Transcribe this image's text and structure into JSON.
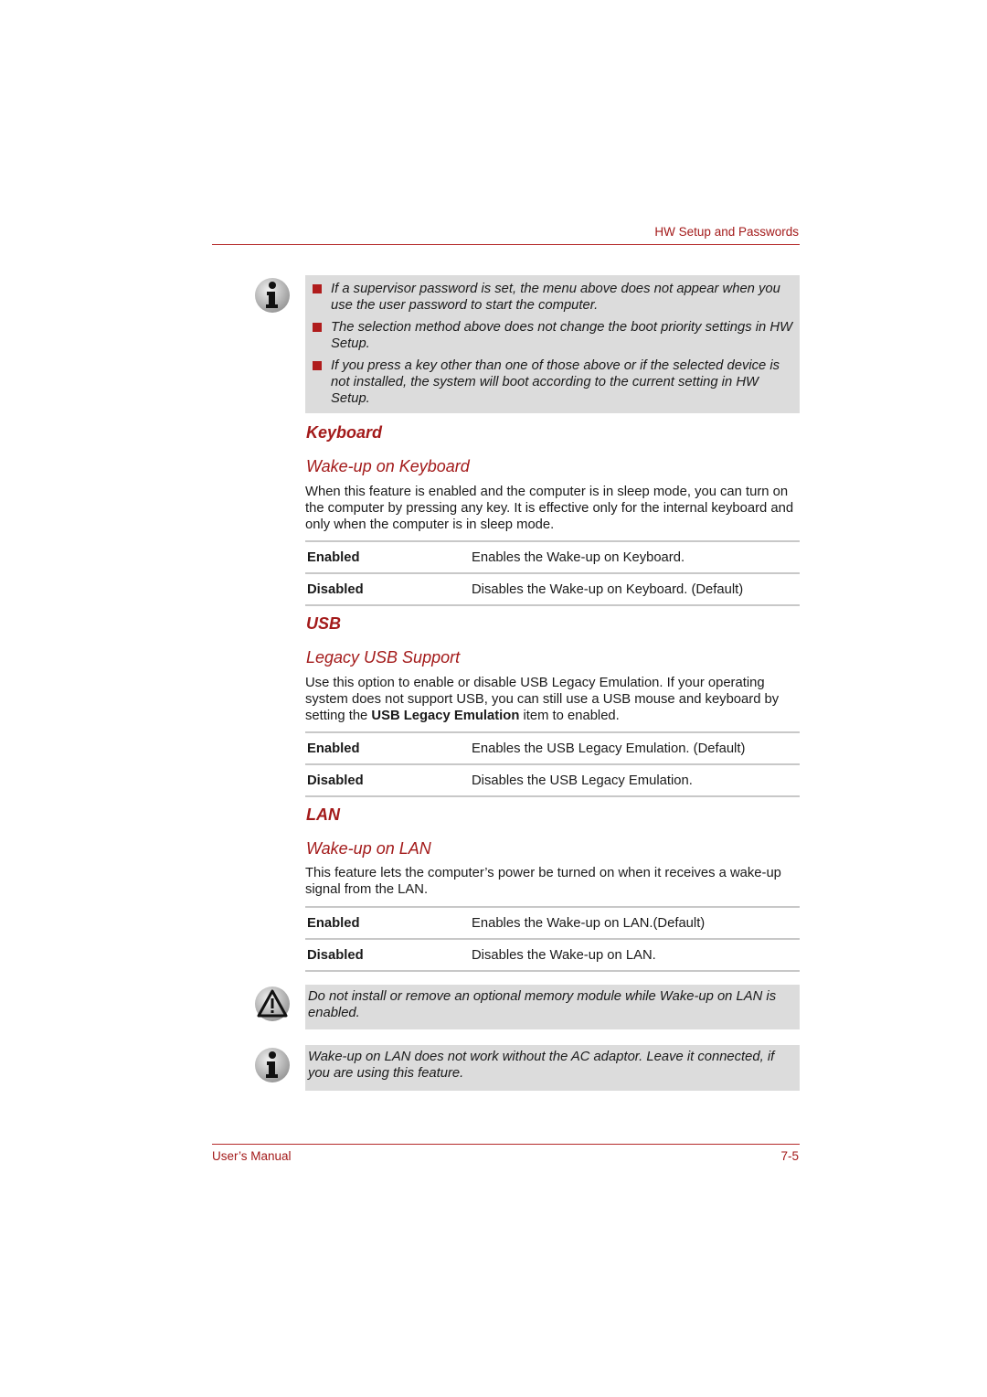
{
  "header": {
    "title": "HW Setup and Passwords"
  },
  "colors": {
    "accent": "#a31a1a",
    "note_bg": "#dcdcdc",
    "rule": "#c8c8c8"
  },
  "top_note": {
    "icon": "info-icon",
    "bullets": [
      "If a supervisor password is set, the menu above does not appear when you use the user password to start the computer.",
      "The selection method above does not change the boot priority settings in HW Setup.",
      "If you press a key other than one of those above or if the selected device is not installed, the system will boot according to the current setting in HW Setup."
    ]
  },
  "sections": {
    "keyboard": {
      "heading": "Keyboard",
      "subheading": "Wake-up on Keyboard",
      "description": "When this feature is enabled and the computer is in sleep mode, you can turn on the computer by pressing any key. It is effective only for the internal keyboard and only when the computer is in sleep mode.",
      "options": [
        {
          "key": "Enabled",
          "value": "Enables the Wake-up on Keyboard."
        },
        {
          "key": "Disabled",
          "value": "Disables the Wake-up on Keyboard. (Default)"
        }
      ]
    },
    "usb": {
      "heading": "USB",
      "subheading": "Legacy USB Support",
      "description_pre": "Use this option to enable or disable USB Legacy Emulation. If your operating system does not support USB, you can still use a USB mouse and keyboard by setting the ",
      "description_bold": "USB Legacy Emulation",
      "description_post": " item to enabled.",
      "options": [
        {
          "key": "Enabled",
          "value": "Enables the USB Legacy Emulation. (Default)"
        },
        {
          "key": "Disabled",
          "value": "Disables the USB Legacy Emulation."
        }
      ]
    },
    "lan": {
      "heading": "LAN",
      "subheading": "Wake-up on LAN",
      "description": "This feature lets the computer’s power be turned on when it receives a wake-up signal from the LAN.",
      "options": [
        {
          "key": "Enabled",
          "value": "Enables the Wake-up on LAN.(Default)"
        },
        {
          "key": "Disabled",
          "value": "Disables the Wake-up on LAN."
        }
      ]
    }
  },
  "warning_note": {
    "icon": "warning-icon",
    "text": "Do not install or remove an optional memory module while Wake-up on LAN is enabled."
  },
  "info_note": {
    "icon": "info-icon",
    "text": "Wake-up on LAN does not work without the AC adaptor. Leave it connected, if you are using this feature."
  },
  "footer": {
    "left": "User’s Manual",
    "right": "7-5"
  }
}
